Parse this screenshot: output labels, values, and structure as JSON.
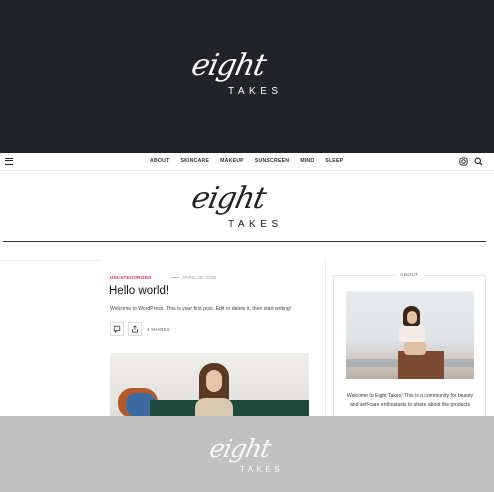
{
  "brand": {
    "script": "eight",
    "word": "TAKES"
  },
  "nav": {
    "items": [
      "ABOUT",
      "SKINCARE",
      "MAKEUP",
      "SUNSCREEN",
      "MIND",
      "SLEEP"
    ],
    "icons": [
      "menu-icon",
      "instagram-icon",
      "search-icon"
    ]
  },
  "post": {
    "category": "UNCATEGORIZED",
    "date": "APRIL 28, 2020",
    "title": "Hello world!",
    "excerpt": "Welcome to WordPress. This is your first post. Edit or delete it, then start writing!",
    "shares": "4 SHARES"
  },
  "sidebar": {
    "heading": "ABOUT",
    "text": "Welcome to Eight Takes! This is a community for beauty and self-care enthusiasts to share about the products"
  },
  "colors": {
    "dark": "#222327",
    "accent": "#e02b58",
    "footer": "#c1c1c1"
  }
}
